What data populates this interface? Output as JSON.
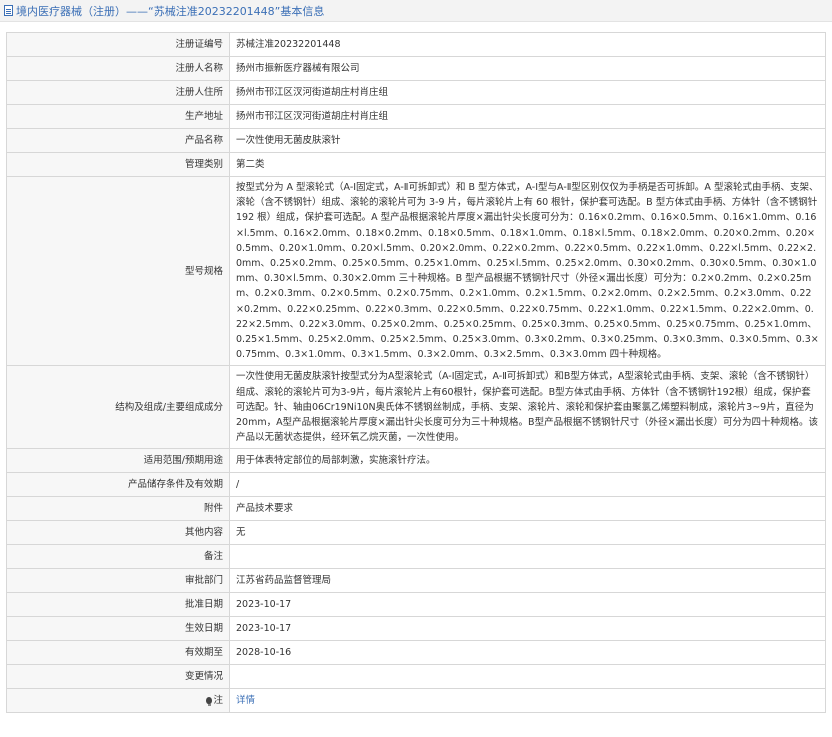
{
  "header": {
    "title": "境内医疗器械（注册）——“苏械注准20232201448”基本信息"
  },
  "rows": [
    {
      "label": "注册证编号",
      "value": "苏械注准20232201448"
    },
    {
      "label": "注册人名称",
      "value": "扬州市振新医疗器械有限公司"
    },
    {
      "label": "注册人住所",
      "value": "扬州市邗江区汊河街道胡庄村肖庄组"
    },
    {
      "label": "生产地址",
      "value": "扬州市邗江区汊河街道胡庄村肖庄组"
    },
    {
      "label": "产品名称",
      "value": "一次性使用无菌皮肤滚针"
    },
    {
      "label": "管理类别",
      "value": "第二类"
    },
    {
      "label": "型号规格",
      "value": "按型式分为 A 型滚轮式（A-Ⅰ固定式，A-Ⅱ可拆卸式）和 B 型方体式，A-Ⅰ型与A-Ⅱ型区别仅仅为手柄是否可拆卸。A 型滚轮式由手柄、支架、滚轮（含不锈钢针）组成、滚轮的滚轮片可为 3-9 片，每片滚轮片上有 60 根针，保护套可选配。B 型方体式由手柄、方体针（含不锈钢针 192 根）组成，保护套可选配。A 型产品根据滚轮片厚度×漏出针尖长度可分为：0.16×0.2mm、0.16×0.5mm、0.16×1.0mm、0.16×l.5mm、0.16×2.0mm、0.18×0.2mm、0.18×0.5mm、0.18×1.0mm、0.18×l.5mm、0.18×2.0mm、0.20×0.2mm、0.20×0.5mm、0.20×1.0mm、0.20×l.5mm、0.20×2.0mm、0.22×0.2mm、0.22×0.5mm、0.22×1.0mm、0.22×l.5mm、0.22×2.0mm、0.25×0.2mm、0.25×0.5mm、0.25×1.0mm、0.25×l.5mm、0.25×2.0mm、0.30×0.2mm、0.30×0.5mm、0.30×1.0mm、0.30×l.5mm、0.30×2.0mm 三十种规格。B 型产品根据不锈钢针尺寸（外径×漏出长度）可分为：0.2×0.2mm、0.2×0.25mm、0.2×0.3mm、0.2×0.5mm、0.2×0.75mm、0.2×1.0mm、0.2×1.5mm、0.2×2.0mm、0.2×2.5mm、0.2×3.0mm、0.22×0.2mm、0.22×0.25mm、0.22×0.3mm、0.22×0.5mm、0.22×0.75mm、0.22×1.0mm、0.22×1.5mm、0.22×2.0mm、0.22×2.5mm、0.22×3.0mm、0.25×0.2mm、0.25×0.25mm、0.25×0.3mm、0.25×0.5mm、0.25×0.75mm、0.25×1.0mm、0.25×1.5mm、0.25×2.0mm、0.25×2.5mm、0.25×3.0mm、0.3×0.2mm、0.3×0.25mm、0.3×0.3mm、0.3×0.5mm、0.3×0.75mm、0.3×1.0mm、0.3×1.5mm、0.3×2.0mm、0.3×2.5mm、0.3×3.0mm 四十种规格。"
    },
    {
      "label": "结构及组成/主要组成成分",
      "value": "一次性使用无菌皮肤滚针按型式分为A型滚轮式（A-Ⅰ固定式，A-Ⅱ可拆卸式）和B型方体式，A型滚轮式由手柄、支架、滚轮（含不锈钢针）组成、滚轮的滚轮片可为3-9片，每片滚轮片上有60根针，保护套可选配。B型方体式由手柄、方体针（含不锈钢针192根）组成，保护套可选配。针、轴由06Cr19Ni10N奥氏体不锈钢丝制成，手柄、支架、滚轮片、滚轮和保护套由聚氯乙烯塑料制成，滚轮片3~9片，直径为20mm，A型产品根据滚轮片厚度×漏出针尖长度可分为三十种规格。B型产品根据不锈钢针尺寸（外径×漏出长度）可分为四十种规格。该产品以无菌状态提供，经环氧乙烷灭菌，一次性使用。"
    },
    {
      "label": "适用范围/预期用途",
      "value": "用于体表特定部位的局部刺激，实施滚针疗法。"
    },
    {
      "label": "产品储存条件及有效期",
      "value": "/"
    },
    {
      "label": "附件",
      "value": "产品技术要求"
    },
    {
      "label": "其他内容",
      "value": "无"
    },
    {
      "label": "备注",
      "value": ""
    },
    {
      "label": "审批部门",
      "value": "江苏省药品监督管理局"
    },
    {
      "label": "批准日期",
      "value": "2023-10-17"
    },
    {
      "label": "生效日期",
      "value": "2023-10-17"
    },
    {
      "label": "有效期至",
      "value": "2028-10-16"
    },
    {
      "label": "变更情况",
      "value": ""
    }
  ],
  "footer_row": {
    "label": "注",
    "icon": "bulb-icon",
    "link": "详情"
  },
  "colors": {
    "title_blue": "#3b6fb6",
    "label_bg": "#f7f7f7",
    "border": "#d7d7d7"
  }
}
